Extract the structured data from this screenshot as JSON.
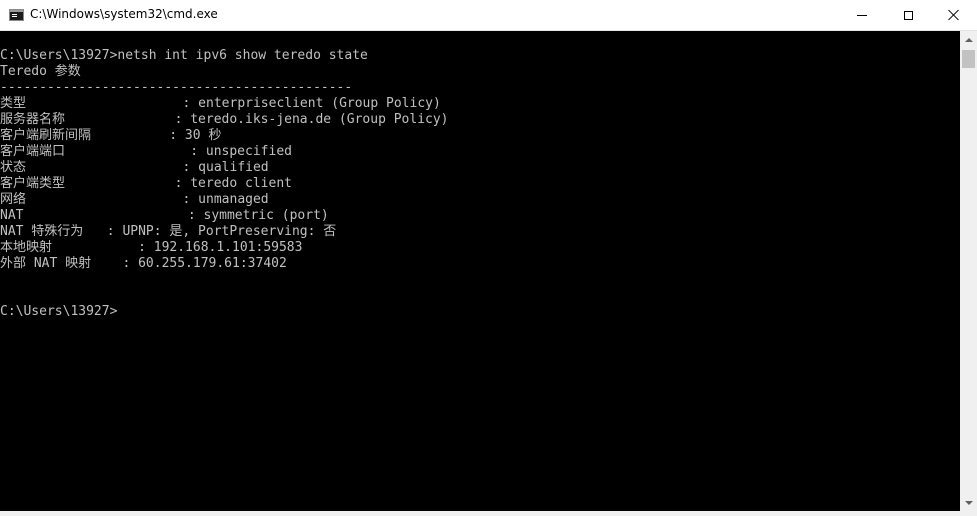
{
  "window": {
    "title": "C:\\Windows\\system32\\cmd.exe",
    "icon": "cmd-icon",
    "controls": [
      "minimize-icon",
      "maximize-icon",
      "close-icon"
    ]
  },
  "console": {
    "text_color": "#c0c0c0",
    "background": "#000000",
    "lines": [
      "C:\\Users\\13927>netsh int ipv6 show teredo state",
      "Teredo 参数",
      "---------------------------------------------",
      "类型                    : enterpriseclient (Group Policy)",
      "服务器名称              : teredo.iks-jena.de (Group Policy)",
      "客户端刷新间隔          : 30 秒",
      "客户端端口                : unspecified",
      "状态                    : qualified",
      "客户端类型              : teredo client",
      "网络                    : unmanaged",
      "NAT                     : symmetric (port)",
      "NAT 特殊行为   : UPNP: 是, PortPreserving: 否",
      "本地映射           : 192.168.1.101:59583",
      "外部 NAT 映射    : 60.255.179.61:37402",
      "",
      "",
      "C:\\Users\\13927>"
    ]
  }
}
